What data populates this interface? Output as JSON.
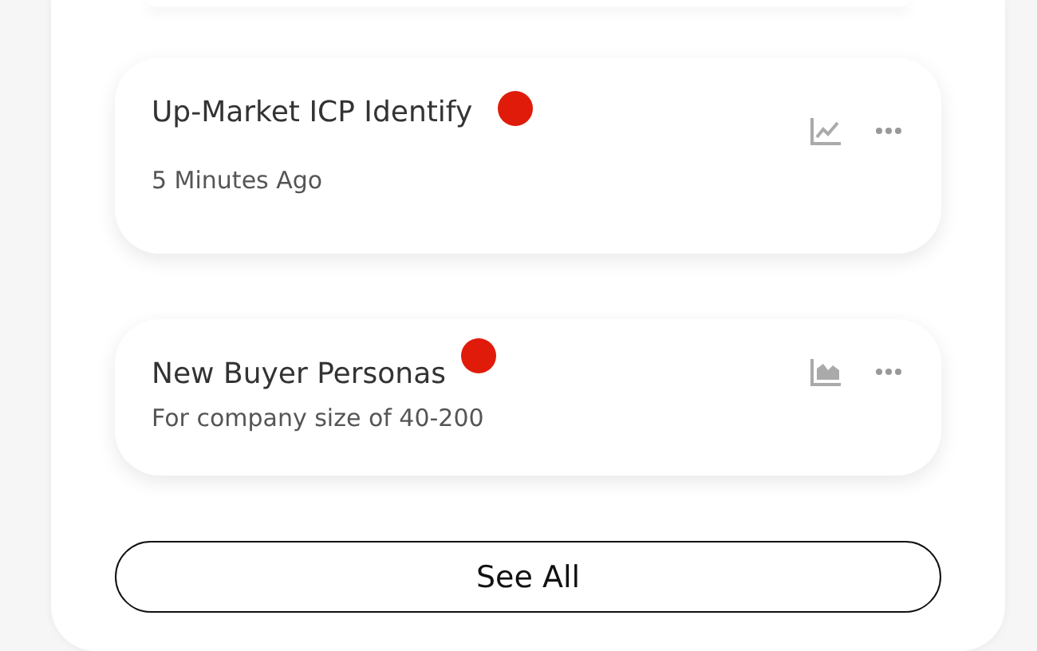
{
  "cards": [
    {
      "title": "Up-Market ICP Identify",
      "subtitle": "5 Minutes Ago",
      "unread": true,
      "kind": "line"
    },
    {
      "title": "New Buyer Personas",
      "subtitle": "For company size of 40-200",
      "unread": true,
      "kind": "area"
    }
  ],
  "see_all_button": "See All"
}
